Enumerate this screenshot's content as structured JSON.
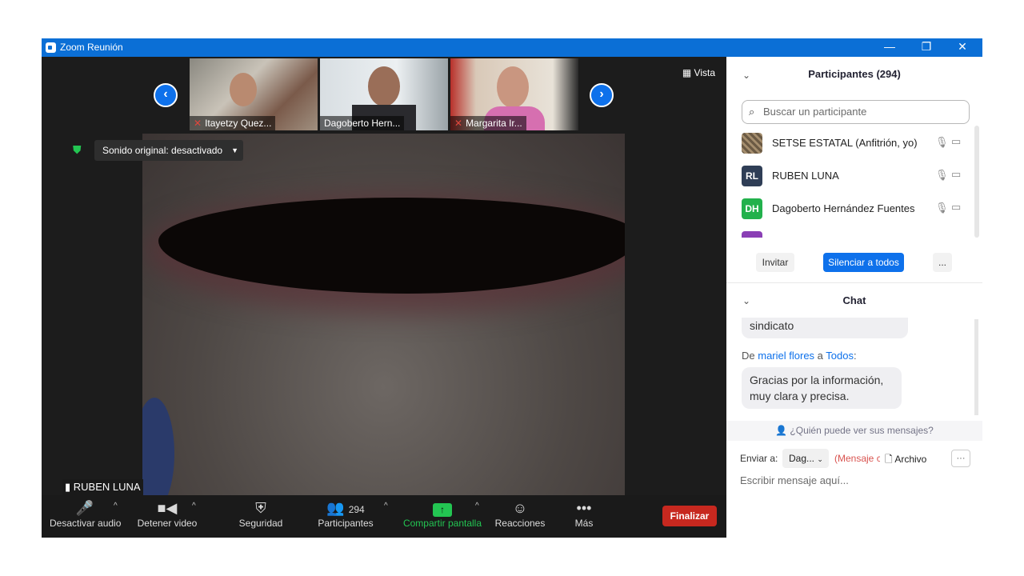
{
  "window": {
    "title": "Zoom Reunión",
    "minimize": "—",
    "restore": "❐",
    "close": "✕"
  },
  "stage": {
    "thumbnails": [
      {
        "name": "Itayetzy Quez...",
        "muted": true
      },
      {
        "name": "Dagoberto Hern...",
        "muted": false
      },
      {
        "name": "Margarita Ir...",
        "muted": true
      }
    ],
    "nav_prev": "‹",
    "nav_next": "›",
    "view_label": "Vista",
    "original_sound": "Sonido original: desactivado",
    "active_speaker": "RUBEN LUNA"
  },
  "toolbar": {
    "audio": "Desactivar audio",
    "video": "Detener video",
    "security": "Seguridad",
    "participants": "Participantes",
    "participants_count": "294",
    "share": "Compartir pantalla",
    "reactions": "Reacciones",
    "more": "Más",
    "end": "Finalizar"
  },
  "participants_panel": {
    "title": "Participantes (294)",
    "search_placeholder": "Buscar un participante",
    "list": [
      {
        "initials": "",
        "name": "SETSE ESTATAL (Anfitrión, yo)",
        "color": "#6b5a44"
      },
      {
        "initials": "RL",
        "name": "RUBEN LUNA",
        "color": "#2f3e56"
      },
      {
        "initials": "DH",
        "name": "Dagoberto Hernández Fuentes",
        "color": "#22b14c"
      }
    ],
    "invite": "Invitar",
    "mute_all": "Silenciar a todos",
    "more": "..."
  },
  "chat": {
    "title": "Chat",
    "prev_message": "sindicato",
    "from_prefix": "De",
    "sender": "mariel flores",
    "to_word": "a",
    "recipient": "Todos",
    "message": "Gracias por la información, muy clara y precisa.",
    "who_can_see": "¿Quién puede ver sus mensajes?",
    "send_to_label": "Enviar a:",
    "send_to_value": "Dag...",
    "private_note": "(Mensaje c",
    "file_label": "Archivo",
    "more": "···",
    "input_placeholder": "Escribir mensaje aquí..."
  },
  "colors": {
    "accent": "#0e71eb",
    "end": "#c7281f",
    "share": "#23c552"
  }
}
